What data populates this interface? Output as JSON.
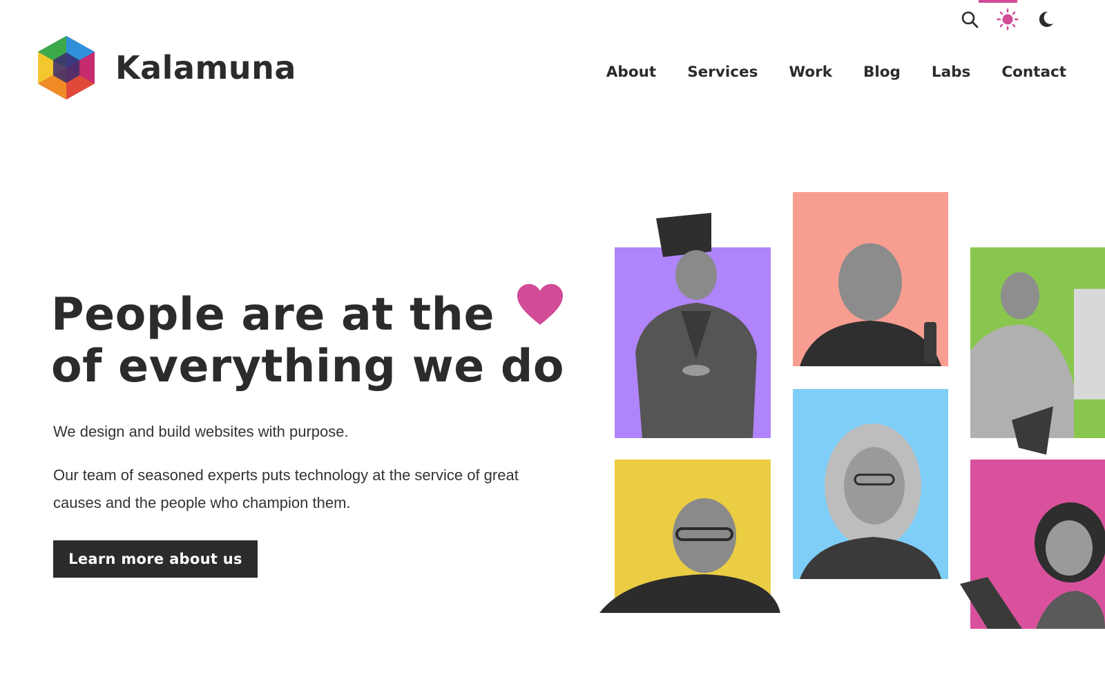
{
  "brand": {
    "name": "Kalamuna"
  },
  "nav": {
    "items": [
      {
        "label": "About"
      },
      {
        "label": "Services"
      },
      {
        "label": "Work"
      },
      {
        "label": "Blog"
      },
      {
        "label": "Labs"
      },
      {
        "label": "Contact"
      }
    ]
  },
  "utility": {
    "search_icon": "search-icon",
    "light_icon": "sun-icon",
    "dark_icon": "moon-icon",
    "active_mode": "light"
  },
  "hero": {
    "title_line1": "People are at the",
    "title_line2": "of everything we do",
    "heart_icon": "heart-icon",
    "subtitle": "We design and build websites with purpose.",
    "body": "Our team of seasoned experts puts technology at the service of great causes and the people who champion them.",
    "cta_label": "Learn more about us"
  },
  "colors": {
    "text": "#2b2b2b",
    "accent": "#d14b97",
    "tile_purple": "#b084fb",
    "tile_salmon": "#f79e91",
    "tile_green": "#89c64e",
    "tile_yellow": "#ebcd44",
    "tile_blue": "#7ecef7",
    "tile_pink": "#d9519c"
  }
}
